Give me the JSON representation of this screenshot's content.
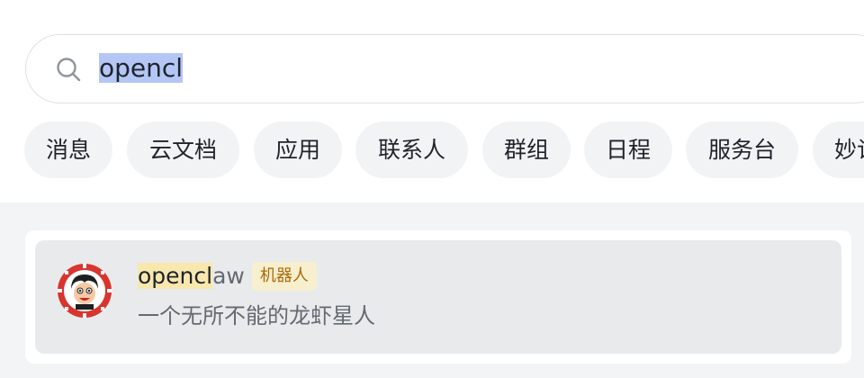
{
  "search": {
    "value": "opencl",
    "icon": "search-icon"
  },
  "filters": [
    {
      "label": "消息"
    },
    {
      "label": "云文档"
    },
    {
      "label": "应用"
    },
    {
      "label": "联系人"
    },
    {
      "label": "群组"
    },
    {
      "label": "日程"
    },
    {
      "label": "服务台"
    },
    {
      "label": "妙记"
    }
  ],
  "result": {
    "name_match": "opencl",
    "name_rest": "aw",
    "badge": "机器人",
    "description": "一个无所不能的龙虾星人",
    "avatar": "robot-avatar"
  },
  "colors": {
    "selection": "#b4c6f5",
    "match_highlight": "#f8e8ae",
    "badge_bg": "#f8efcf",
    "badge_text": "#a86b08"
  }
}
